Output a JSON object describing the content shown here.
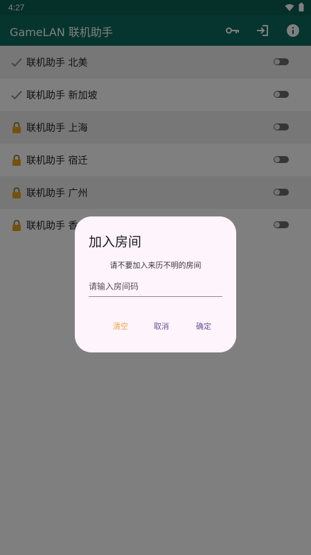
{
  "status_bar": {
    "time": "4:27",
    "icons": [
      "wifi-icon",
      "battery-icon"
    ]
  },
  "app_bar": {
    "title": "GameLAN 联机助手",
    "actions": [
      "key-icon",
      "login-icon",
      "info-icon"
    ]
  },
  "list": {
    "items": [
      {
        "label": "联机助手 北美",
        "status_icon": "check-icon",
        "toggle_on": false
      },
      {
        "label": "联机助手 新加坡",
        "status_icon": "check-icon",
        "toggle_on": false
      },
      {
        "label": "联机助手 上海",
        "status_icon": "lock-icon",
        "toggle_on": false
      },
      {
        "label": "联机助手 宿迁",
        "status_icon": "lock-icon",
        "toggle_on": false
      },
      {
        "label": "联机助手 广州",
        "status_icon": "lock-icon",
        "toggle_on": false
      },
      {
        "label": "联机助手 香",
        "status_icon": "lock-icon",
        "toggle_on": false
      }
    ]
  },
  "dialog": {
    "title": "加入房间",
    "message": "请不要加入来历不明的房间",
    "input_placeholder": "请输入房间码",
    "input_value": "",
    "buttons": {
      "clear": "清空",
      "cancel": "取消",
      "confirm": "确定"
    }
  },
  "colors": {
    "status_bar": "#0b5e52",
    "app_bar": "#0b6b5d",
    "dialog_bg": "#fdf5fb",
    "clear_button": "#f3a23a",
    "dialog_button": "#6a4f9e",
    "lock": "#e8a21c"
  }
}
